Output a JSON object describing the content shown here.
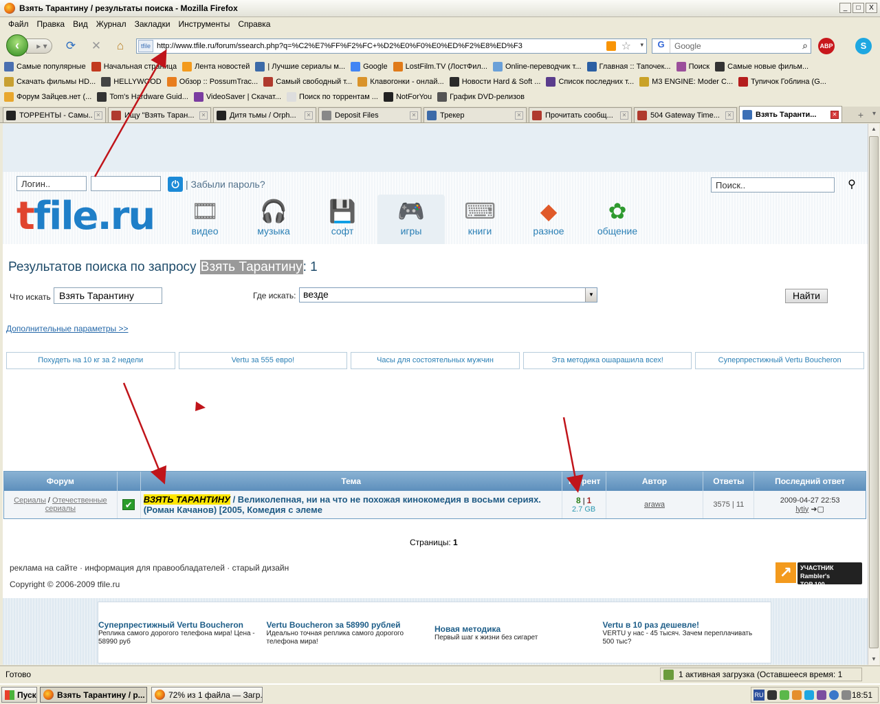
{
  "window": {
    "title": "Взять Тарантину / результаты поиска - Mozilla Firefox",
    "min": "_",
    "max": "□",
    "close": "X"
  },
  "menu": [
    "Файл",
    "Правка",
    "Вид",
    "Журнал",
    "Закладки",
    "Инструменты",
    "Справка"
  ],
  "nav": {
    "url": "http://www.tfile.ru/forum/ssearch.php?q=%C2%E7%FF%F2%FC+%D2%E0%F0%E0%ED%F2%E8%ED%F3",
    "site_label": "tfile",
    "search_placeholder": "Google",
    "search_engine": "G",
    "abp": "ABP",
    "skype": "S"
  },
  "bookmarks_row1": [
    {
      "label": "Самые популярные",
      "color": "#4a6fb0"
    },
    {
      "label": "Начальная страница",
      "color": "#c23a1f"
    },
    {
      "label": "Лента новостей",
      "color": "#f39a1d"
    },
    {
      "label": "| Лучшие сериалы м...",
      "color": "#3c6aa8"
    },
    {
      "label": "Google",
      "color": "#4285f4"
    },
    {
      "label": "LostFilm.TV (ЛостФил...",
      "color": "#e07b1a"
    },
    {
      "label": "Online-переводчик т...",
      "color": "#6aa0d8"
    },
    {
      "label": "Главная :: Тапочек...",
      "color": "#2b5fa3"
    },
    {
      "label": "Поиск",
      "color": "#9b4f9b"
    },
    {
      "label": "Самые новые фильм...",
      "color": "#333333"
    }
  ],
  "bookmarks_row2": [
    {
      "label": "Скачать фильмы HD...",
      "color": "#c8a032"
    },
    {
      "label": "HELLYWOOD",
      "color": "#444444"
    },
    {
      "label": "Обзор :: PossumTrac...",
      "color": "#e87d1e"
    },
    {
      "label": "Самый свободный т...",
      "color": "#b03a2e"
    },
    {
      "label": "Клавогонки - онлай...",
      "color": "#d9932a"
    },
    {
      "label": "Новости Hard & Soft ...",
      "color": "#2a2a2a"
    },
    {
      "label": "Список последних т...",
      "color": "#5a3c8c"
    },
    {
      "label": "M3 ENGINE: Moder C...",
      "color": "#c9a227"
    },
    {
      "label": "Тупичок Гоблина (G...",
      "color": "#b51d1d"
    }
  ],
  "bookmarks_row3": [
    {
      "label": "Форум Зайцев.нет (...",
      "color": "#e8a72e"
    },
    {
      "label": "Tom's Hardware Guid...",
      "color": "#333333"
    },
    {
      "label": "VideoSaver | Скачат...",
      "color": "#7a3ca0"
    },
    {
      "label": "Поиск по торрентам ...",
      "color": "#dddddd"
    },
    {
      "label": "NotForYou",
      "color": "#222222"
    },
    {
      "label": "График DVD-релизов",
      "color": "#555555"
    }
  ],
  "tabs": [
    {
      "label": "ТОРРЕНТЫ - Самы...",
      "color": "#222222",
      "active": false
    },
    {
      "label": "Ищу \"Взять Таран...",
      "color": "#b03a2e",
      "active": false
    },
    {
      "label": "Дитя тьмы / Orph...",
      "color": "#222222",
      "active": false
    },
    {
      "label": "Deposit Files",
      "color": "#888888",
      "active": false
    },
    {
      "label": "Трекер",
      "color": "#3c6aa8",
      "active": false
    },
    {
      "label": "Прочитать сообщ...",
      "color": "#b03a2e",
      "active": false
    },
    {
      "label": "504 Gateway Time...",
      "color": "#b03a2e",
      "active": false
    },
    {
      "label": "Взять Таранти...",
      "color": "#3b6fb6",
      "active": true
    }
  ],
  "page": {
    "login_placeholder": "Логин..",
    "forgot": "| Забыли пароль?",
    "search_placeholder": "Поиск..",
    "logo_t": "t",
    "logo_rest": "file.ru",
    "categories": [
      {
        "label": "видео",
        "icon": "film-reel-icon",
        "glyph": "🎞"
      },
      {
        "label": "музыка",
        "icon": "headphones-icon",
        "glyph": "🎧"
      },
      {
        "label": "софт",
        "icon": "software-disk-icon",
        "glyph": "💾"
      },
      {
        "label": "игры",
        "icon": "gamepad-icon",
        "glyph": "🎮"
      },
      {
        "label": "книги",
        "icon": "typewriter-icon",
        "glyph": "⌨"
      },
      {
        "label": "разное",
        "icon": "puzzle-blocks-icon",
        "glyph": "◆"
      },
      {
        "label": "общение",
        "icon": "icq-flower-icon",
        "glyph": "✿"
      }
    ],
    "result_prefix": "Результатов поиска по запросу ",
    "result_query": "Взять Тарантину",
    "result_suffix": ": 1",
    "what_label": "Что искать",
    "what_value": "Взять Тарантину",
    "where_label": "Где искать:",
    "where_value": "везде",
    "find_button": "Найти",
    "advanced_link": "Дополнительные параметры >>",
    "ads": [
      "Похудеть на 10 кг за 2 недели",
      "Vertu за 555 евро!",
      "Часы для состоятельных мужчин",
      "Эта методика ошарашила всех!",
      "Суперпрестижный Vertu Boucheron"
    ],
    "table": {
      "headers": [
        "Форум",
        "",
        "Тема",
        "Торрент",
        "Автор",
        "Ответы",
        "Последний ответ"
      ],
      "row": {
        "forum_a": "Сериалы",
        "forum_sep": " / ",
        "forum_b": "Отечественные сериалы",
        "topic_hl": "ВЗЯТЬ ТАРАНТИНУ",
        "topic_rest": " / Великолепная, ни на что не похожая кинокомедия в восьми сериях. (Роман Качанов) [2005, Комедия с элеме",
        "seeds": "8",
        "torr_sep": " | ",
        "leech": "1",
        "size": "2.7 GB",
        "author": "arawa",
        "replies": "3575 | 11",
        "last_date": "2009-04-27 22:53",
        "last_user": "lytiy"
      }
    },
    "pages_label": "Страницы: ",
    "pages_value": "1",
    "footer_links": "реклама на сайте · информация для правообладателей · старый дизайн",
    "copyright": "Copyright © 2006-2009 tfile.ru",
    "rambler_badge_1": "УЧАСТНИК",
    "rambler_badge_2": "Rambler's",
    "rambler_badge_3": "TOP 100",
    "bottom_ads": [
      {
        "title": "Суперпрестижный Vertu Boucheron",
        "desc": "Реплика самого дорогого телефона мира! Цена - 58990 руб"
      },
      {
        "title": "Vertu Boucheron за 58990 рублей",
        "desc": "Идеально точная реплика самого дорогого телефона мира!"
      },
      {
        "title": "Новая методика",
        "desc": "Первый шаг к жизни без сигарет"
      },
      {
        "title": "Vertu в 10 раз дешевле!",
        "desc": "VERTU у нас - 45 тысяч. Зачем переплачивать 500 тыс?"
      }
    ]
  },
  "status": {
    "text": "Готово",
    "download": "1 активная загрузка (Оставшееся время: 1 минута)"
  },
  "taskbar": {
    "start": "Пуск",
    "items": [
      "Взять Тарантину / р...",
      "72% из 1 файла — Загр..."
    ],
    "lang": "RU",
    "clock": "18:51"
  },
  "colors": {
    "accent": "#2a7fb5",
    "logo_red": "#e0452f",
    "logo_blue": "#1f7fc8",
    "header_bar": "#6f9ec2",
    "annotation_arrow": "#c0141a"
  }
}
